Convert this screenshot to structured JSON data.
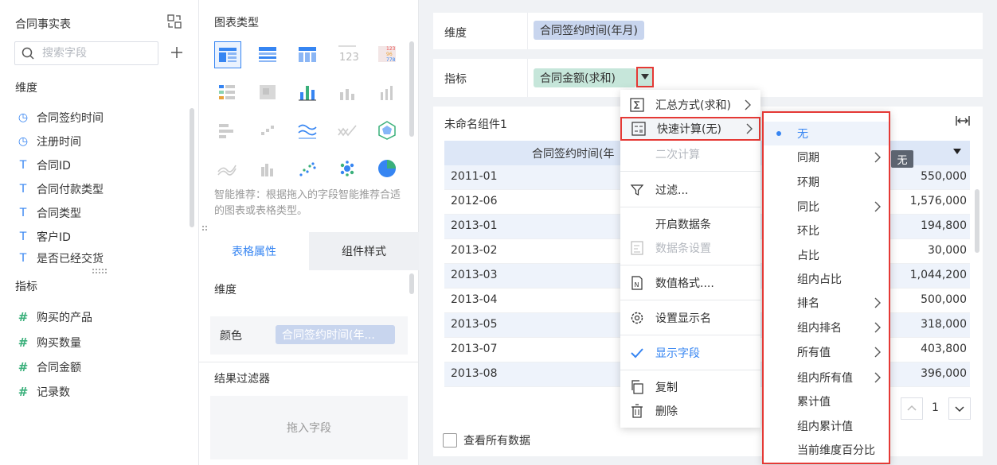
{
  "left_panel": {
    "title": "合同事实表",
    "search_placeholder": "搜索字段",
    "dimension_label": "维度",
    "dimensions": [
      "合同签约时间",
      "注册时间",
      "合同ID",
      "合同付款类型",
      "合同类型",
      "客户ID",
      "是否已经交货"
    ],
    "measure_label": "指标",
    "measures": [
      "购买的产品",
      "购买数量",
      "合同金额",
      "记录数"
    ]
  },
  "middle_panel": {
    "chart_type_title": "图表类型",
    "hint": "智能推荐：根据拖入的字段智能推荐合适的图表或表格类型。",
    "tabs": [
      "表格属性",
      "组件样式"
    ],
    "dimension_label": "维度",
    "color_label": "颜色",
    "color_chip": "合同签约时间(年...",
    "result_filter_title": "结果过滤器",
    "drop_hint": "拖入字段"
  },
  "config": {
    "dimension_label": "维度",
    "dimension_chip": "合同签约时间(年月)",
    "measure_label": "指标",
    "measure_chip": "合同金额(求和)"
  },
  "widget": {
    "title": "未命名组件1",
    "col1_header": "合同签约时间(年",
    "rows": [
      {
        "date": "2011-01",
        "value": "550,000"
      },
      {
        "date": "2012-06",
        "value": "1,576,000"
      },
      {
        "date": "2013-01",
        "value": "194,800"
      },
      {
        "date": "2013-02",
        "value": "30,000"
      },
      {
        "date": "2013-03",
        "value": "1,044,200"
      },
      {
        "date": "2013-04",
        "value": "500,000"
      },
      {
        "date": "2013-05",
        "value": "318,000"
      },
      {
        "date": "2013-07",
        "value": "403,800"
      },
      {
        "date": "2013-08",
        "value": "396,000"
      }
    ],
    "page": "1",
    "show_all": "查看所有数据"
  },
  "menu1": {
    "summary": "汇总方式(求和)",
    "quick_calc": "快速计算(无)",
    "secondary_calc": "二次计算",
    "filter": "过滤...",
    "enable_databar": "开启数据条",
    "databar_settings": "数据条设置",
    "number_format": "数值格式....",
    "display_name": "设置显示名",
    "show_field": "显示字段",
    "copy": "复制",
    "delete": "删除"
  },
  "menu2": {
    "items": [
      "无",
      "同期",
      "环期",
      "同比",
      "环比",
      "占比",
      "组内占比",
      "排名",
      "组内排名",
      "所有值",
      "组内所有值",
      "累计值",
      "组内累计值",
      "当前维度百分比"
    ]
  },
  "tooltip": "无",
  "colors": {
    "accent": "#3685f2",
    "highlight": "#e53935",
    "dim_chip": "#c8d5ee",
    "measure_chip": "#c6e6da"
  }
}
